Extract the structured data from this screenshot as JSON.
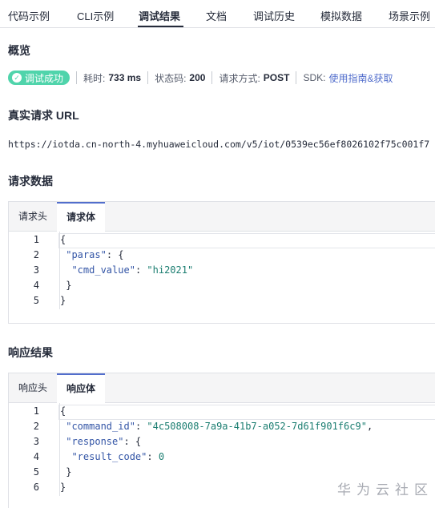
{
  "tabs": {
    "items": [
      {
        "label": "代码示例"
      },
      {
        "label": "CLI示例"
      },
      {
        "label": "调试结果"
      },
      {
        "label": "文档"
      },
      {
        "label": "调试历史"
      },
      {
        "label": "模拟数据"
      },
      {
        "label": "场景示例"
      }
    ],
    "active": "调试结果"
  },
  "overview": {
    "title": "概览",
    "status_label": "调试成功",
    "elapsed_key": "耗时:",
    "elapsed_value": "733 ms",
    "status_code_key": "状态码:",
    "status_code_value": "200",
    "method_key": "请求方式:",
    "method_value": "POST",
    "sdk_key": "SDK:",
    "sdk_link": "使用指南&获取"
  },
  "request_url": {
    "title": "真实请求 URL",
    "value": "https://iotda.cn-north-4.myhuaweicloud.com/v5/iot/0539ec56ef8026102f75c001f7"
  },
  "request_data": {
    "title": "请求数据",
    "tabs": [
      "请求头",
      "请求体"
    ],
    "active_tab": "请求体",
    "lines": [
      {
        "no": "1",
        "tokens": [
          {
            "t": "{",
            "c": "pun"
          }
        ]
      },
      {
        "no": "2",
        "tokens": [
          {
            "t": " ",
            "c": "pun"
          },
          {
            "t": "\"paras\"",
            "c": "key"
          },
          {
            "t": ": {",
            "c": "pun"
          }
        ]
      },
      {
        "no": "3",
        "tokens": [
          {
            "t": "  ",
            "c": "pun"
          },
          {
            "t": "\"cmd_value\"",
            "c": "key"
          },
          {
            "t": ": ",
            "c": "pun"
          },
          {
            "t": "\"hi2021\"",
            "c": "str"
          }
        ]
      },
      {
        "no": "4",
        "tokens": [
          {
            "t": " }",
            "c": "pun"
          }
        ]
      },
      {
        "no": "5",
        "tokens": [
          {
            "t": "}",
            "c": "pun"
          }
        ]
      }
    ]
  },
  "response": {
    "title": "响应结果",
    "tabs": [
      "响应头",
      "响应体"
    ],
    "active_tab": "响应体",
    "lines": [
      {
        "no": "1",
        "tokens": [
          {
            "t": "{",
            "c": "pun"
          }
        ]
      },
      {
        "no": "2",
        "tokens": [
          {
            "t": " ",
            "c": "pun"
          },
          {
            "t": "\"command_id\"",
            "c": "key"
          },
          {
            "t": ": ",
            "c": "pun"
          },
          {
            "t": "\"4c508008-7a9a-41b7-a052-7d61f901f6c9\"",
            "c": "str"
          },
          {
            "t": ",",
            "c": "pun"
          }
        ]
      },
      {
        "no": "3",
        "tokens": [
          {
            "t": " ",
            "c": "pun"
          },
          {
            "t": "\"response\"",
            "c": "key"
          },
          {
            "t": ": {",
            "c": "pun"
          }
        ]
      },
      {
        "no": "4",
        "tokens": [
          {
            "t": "  ",
            "c": "pun"
          },
          {
            "t": "\"result_code\"",
            "c": "key"
          },
          {
            "t": ": ",
            "c": "pun"
          },
          {
            "t": "0",
            "c": "num"
          }
        ]
      },
      {
        "no": "5",
        "tokens": [
          {
            "t": " }",
            "c": "pun"
          }
        ]
      },
      {
        "no": "6",
        "tokens": [
          {
            "t": "}",
            "c": "pun"
          }
        ]
      }
    ]
  },
  "watermark": "华为云社区",
  "colors": {
    "success": "#50d4ab",
    "link": "#526ecc",
    "json_key": "#3355a6",
    "json_string": "#1a7d70"
  },
  "icons": {
    "status": "check-circle-icon"
  }
}
